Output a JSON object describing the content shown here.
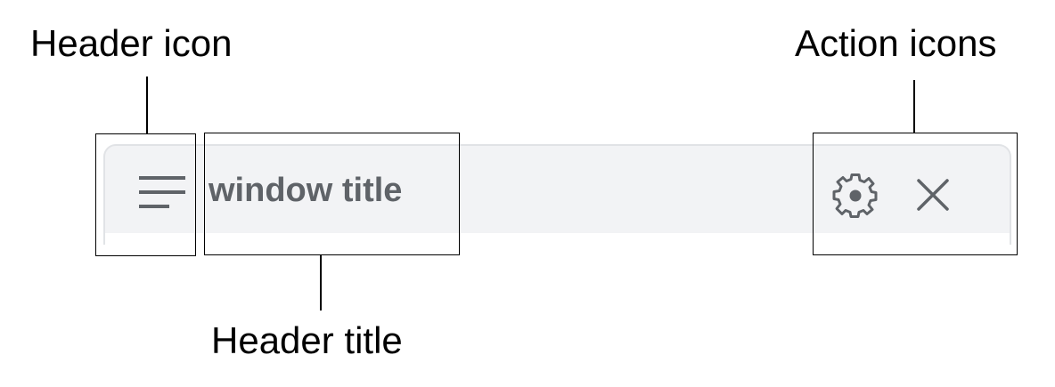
{
  "callouts": {
    "header_icon": "Header icon",
    "header_title": "Header title",
    "action_icons": "Action icons"
  },
  "window": {
    "title": "window title",
    "icons": {
      "menu": "menu-icon",
      "settings": "gear-icon",
      "close": "close-icon"
    }
  },
  "colors": {
    "header_background": "#f2f3f5",
    "header_border": "#e1e3e6",
    "icon_color": "#5f6368",
    "callout_color": "#000000"
  }
}
